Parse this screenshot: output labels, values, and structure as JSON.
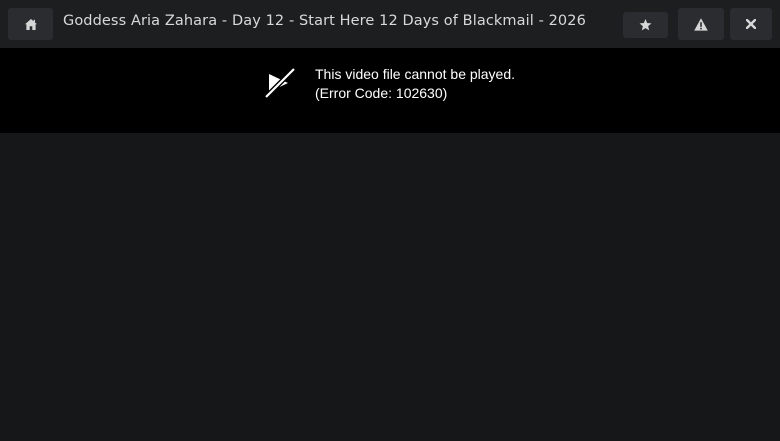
{
  "header": {
    "title": "Goddess Aria Zahara - Day 12 - Start Here 12 Days of Blackmail - 2026",
    "home_icon": "home-icon",
    "favorite_icon": "star-icon",
    "report_icon": "warning-icon",
    "close_icon": "close-icon"
  },
  "player": {
    "error_icon": "video-slash-icon",
    "error_line1": "This video file cannot be played.",
    "error_line2": "(Error Code: 102630)"
  },
  "colors": {
    "topbar": "#1c1e20",
    "button": "#2a2c2f",
    "player_bg": "#000000",
    "page_bg": "#161718"
  }
}
